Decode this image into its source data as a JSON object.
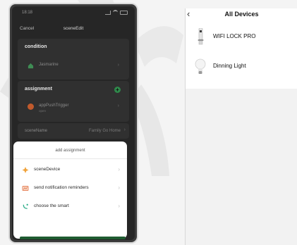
{
  "left_phone": {
    "status_time": "18:18",
    "nav": {
      "cancel": "Cancel",
      "title": "sceneEdit"
    },
    "condition": {
      "title": "condition",
      "row_name": "Jasmarine"
    },
    "assignment": {
      "title": "assignment",
      "row_name": "appPushTrigger",
      "row_sub": "open"
    },
    "scene_name": {
      "label": "sceneName",
      "value": "Family Go Home"
    },
    "sheet": {
      "title": "add assignment",
      "items": [
        {
          "label": "sceneDevice",
          "icon": "device-icon"
        },
        {
          "label": "send notification reminders",
          "icon": "notification-icon"
        },
        {
          "label": "choose the smart",
          "icon": "smart-icon"
        }
      ]
    }
  },
  "right_phone": {
    "title": "All Devices",
    "devices": [
      {
        "name": "WIFI LOCK PRO",
        "icon": "lock-icon"
      },
      {
        "name": "Dinning Light",
        "icon": "bulb-icon"
      }
    ]
  },
  "colors": {
    "accent_green": "#2f8a4b",
    "sheet_bg": "#ffffff",
    "dark_bg": "#262626"
  }
}
